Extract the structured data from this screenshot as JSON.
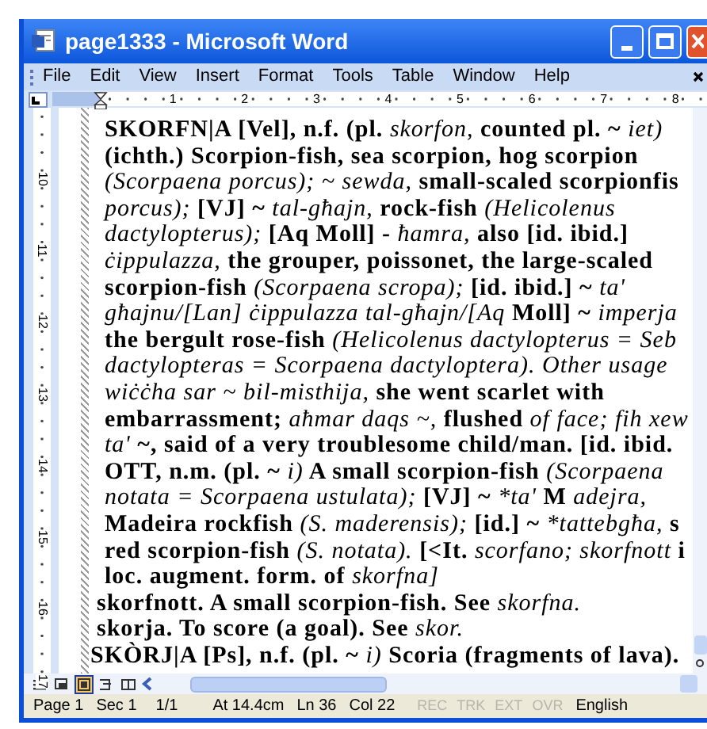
{
  "window": {
    "title": "page1333 - Microsoft Word"
  },
  "menu": [
    "File",
    "Edit",
    "View",
    "Insert",
    "Format",
    "Tools",
    "Table",
    "Window",
    "Help"
  ],
  "horizontal_ruler": [
    "1",
    "2",
    "3",
    "4",
    "5",
    "6",
    "7",
    "8"
  ],
  "vertical_ruler": [
    "10",
    "11",
    "12",
    "13",
    "14",
    "15",
    "16",
    "17"
  ],
  "paragraphs": [
    {
      "kind": "continuation",
      "lines": [
        [
          {
            "text": "SKORFN|A [Vel], n.f. (pl. "
          },
          {
            "text": "skorfon,",
            "italic": true
          },
          {
            "text": " counted pl. ~ "
          },
          {
            "text": "iet)",
            "italic": true
          }
        ],
        [
          {
            "text": "(ichth.) Scorpion-fish, sea scorpion, hog scorpion"
          }
        ],
        [
          {
            "text": "(Scorpaena porcus); ~ sewda,",
            "italic": true
          },
          {
            "text": " small-scaled scorpionfis"
          }
        ],
        [
          {
            "text": "porcus);",
            "italic": true
          },
          {
            "text": " [VJ] ~ "
          },
          {
            "text": "tal-għajn,",
            "italic": true
          },
          {
            "text": " rock-fish "
          },
          {
            "text": "(Helicolenus",
            "italic": true
          }
        ],
        [
          {
            "text": "dactylopterus);",
            "italic": true
          },
          {
            "text": " [Aq Moll] - "
          },
          {
            "text": "ħamra,",
            "italic": true
          },
          {
            "text": " also [id. ibid.]"
          }
        ],
        [
          {
            "text": "ċippulazza,",
            "italic": true
          },
          {
            "text": " the grouper, poissonet, the large-scaled"
          }
        ],
        [
          {
            "text": "scorpion-fish "
          },
          {
            "text": "(Scorpaena scropa);",
            "italic": true
          },
          {
            "text": " [id. ibid.] ~ "
          },
          {
            "text": "ta'",
            "italic": true
          }
        ],
        [
          {
            "text": "għajnu/[Lan] ċippulazza tal-għajn/[Aq",
            "italic": true
          },
          {
            "text": " Moll] ~ "
          },
          {
            "text": "imperja",
            "italic": true
          }
        ],
        [
          {
            "text": "the bergult rose-fish "
          },
          {
            "text": "(Helicolenus dactylopterus = Seb",
            "italic": true
          }
        ],
        [
          {
            "text": "dactylopteras = Scorpaena dactyloptera). Other usage",
            "italic": true
          }
        ],
        [
          {
            "text": "wiċċha sar ~ bil-misthija,",
            "italic": true
          },
          {
            "text": " she went scarlet with"
          }
        ],
        [
          {
            "text": "embarrassment; "
          },
          {
            "text": "aħmar daqs ~,",
            "italic": true
          },
          {
            "text": " flushed "
          },
          {
            "text": "of face; fih xew",
            "italic": true
          }
        ],
        [
          {
            "text": "ta'",
            "italic": true
          },
          {
            "text": " ~, said of a very troublesome child/man. [id. ibid."
          }
        ],
        [
          {
            "text": "OTT, n.m. (pl. ~ "
          },
          {
            "text": "i)",
            "italic": true
          },
          {
            "text": " A small scorpion-fish "
          },
          {
            "text": "(Scorpaena",
            "italic": true
          }
        ],
        [
          {
            "text": "notata = Scorpaena ustulata);",
            "italic": true
          },
          {
            "text": " [VJ] ~ "
          },
          {
            "text": "*ta'",
            "italic": true
          },
          {
            "text": " M "
          },
          {
            "text": "adejra,",
            "italic": true
          }
        ],
        [
          {
            "text": "Madeira rockfish "
          },
          {
            "text": "(S. maderensis);",
            "italic": true
          },
          {
            "text": " [id.] ~ "
          },
          {
            "text": "*tattebgħa,",
            "italic": true
          },
          {
            "text": " s"
          }
        ],
        [
          {
            "text": "red scorpion-fish "
          },
          {
            "text": "(S. notata).",
            "italic": true
          },
          {
            "text": " [<It. "
          },
          {
            "text": "scorfano; skorfnott",
            "italic": true
          },
          {
            "text": " i"
          }
        ],
        [
          {
            "text": "loc. augment. form. of "
          },
          {
            "text": "skorfna]",
            "italic": true
          }
        ]
      ]
    },
    {
      "kind": "subentry",
      "lines": [
        [
          {
            "text": "skorfnott. A small scorpion-fish. See "
          },
          {
            "text": "skorfna.",
            "italic": true
          }
        ],
        [
          {
            "text": "skorja. To score (a goal). See "
          },
          {
            "text": "skor.",
            "italic": true
          }
        ]
      ]
    },
    {
      "kind": "entry",
      "lines": [
        [
          {
            "text": "SKÒRJ|A [Ps], n.f. (pl. ~ "
          },
          {
            "text": "i)",
            "italic": true
          },
          {
            "text": " Scoria (fragments of lava)."
          }
        ]
      ]
    }
  ],
  "view_buttons": [
    {
      "selected": false
    },
    {
      "selected": false
    },
    {
      "selected": true
    },
    {
      "selected": false
    },
    {
      "selected": false
    }
  ],
  "status_bar": {
    "fields": [
      "Page 1",
      "Sec 1",
      "1/1",
      "At 14.4cm",
      "Ln 36",
      "Col 22"
    ],
    "modes": [
      {
        "label": "REC",
        "on": false
      },
      {
        "label": "TRK",
        "on": false
      },
      {
        "label": "EXT",
        "on": false
      },
      {
        "label": "OVR",
        "on": false
      }
    ],
    "language": "English"
  }
}
